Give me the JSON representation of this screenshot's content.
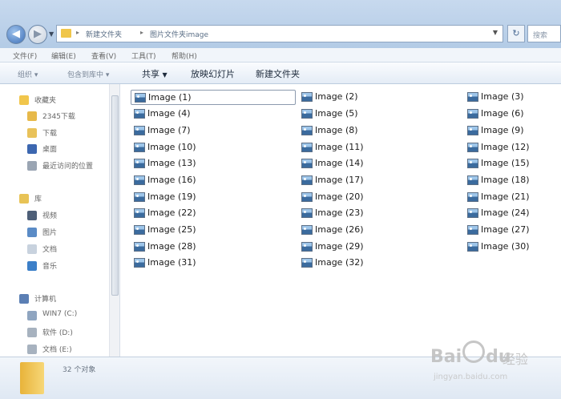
{
  "address": {
    "crumbs": [
      "新建文件夹",
      "图片文件夹image"
    ],
    "search_placeholder": "搜索"
  },
  "menu": [
    "文件(F)",
    "编辑(E)",
    "查看(V)",
    "工具(T)",
    "帮助(H)"
  ],
  "commands": {
    "organize": "组织",
    "include_in_library": "包含到库中",
    "share": "共享",
    "slideshow": "放映幻灯片",
    "new_folder": "新建文件夹"
  },
  "nav": {
    "favorites": "收藏夹",
    "favorites_items": [
      "2345下载",
      "下载",
      "桌面",
      "最近访问的位置"
    ],
    "libraries": "库",
    "libraries_items": [
      "视频",
      "图片",
      "文档",
      "音乐"
    ],
    "computer": "计算机",
    "computer_items": [
      "WIN7 (C:)",
      "软件 (D:)",
      "文档 (E:)"
    ]
  },
  "files": [
    "Image (1)",
    "Image (2)",
    "Image (3)",
    "Image (4)",
    "Image (5)",
    "Image (6)",
    "Image (7)",
    "Image (8)",
    "Image (9)",
    "Image (10)",
    "Image (11)",
    "Image (12)",
    "Image (13)",
    "Image (14)",
    "Image (15)",
    "Image (16)",
    "Image (17)",
    "Image (18)",
    "Image (19)",
    "Image (20)",
    "Image (21)",
    "Image (22)",
    "Image (23)",
    "Image (24)",
    "Image (25)",
    "Image (26)",
    "Image (27)",
    "Image (28)",
    "Image (29)",
    "Image (30)",
    "Image (31)",
    "Image (32)"
  ],
  "details": {
    "count": "32 个对象"
  },
  "watermark": {
    "brand": "Bai",
    "brand2": "du",
    "sub": "经验",
    "url": "jingyan.baidu.com"
  }
}
